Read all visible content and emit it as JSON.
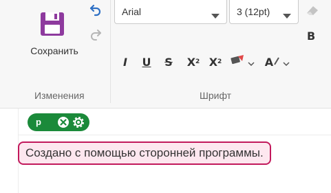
{
  "save": {
    "label": "Сохранить"
  },
  "groups": {
    "changes": "Изменения",
    "font": "Шрифт"
  },
  "font": {
    "family": "Arial",
    "size": "3 (12pt)"
  },
  "format": {
    "bold": "B",
    "italic": "I",
    "underline": "U",
    "strike": "S",
    "subscript": "X",
    "subscript_mark": "2",
    "superscript": "X",
    "superscript_mark": "2",
    "font_color_letter": "A"
  },
  "tag": {
    "name": "p"
  },
  "paragraph": {
    "text": "Создано с помощью сторонней программы."
  },
  "colors": {
    "accent": "#1b8a3a",
    "save_icon": "#8e3a9e",
    "undo_icon": "#2d6fc4",
    "highlight_border": "#c2185b",
    "highlight_bg": "#fde7ef"
  },
  "icons": {
    "save": "floppy-disk-icon",
    "undo": "undo-icon",
    "redo": "redo-icon",
    "eraser": "eraser-icon",
    "highlighter": "highlighter-icon",
    "close": "close-icon",
    "gear": "gear-icon"
  }
}
